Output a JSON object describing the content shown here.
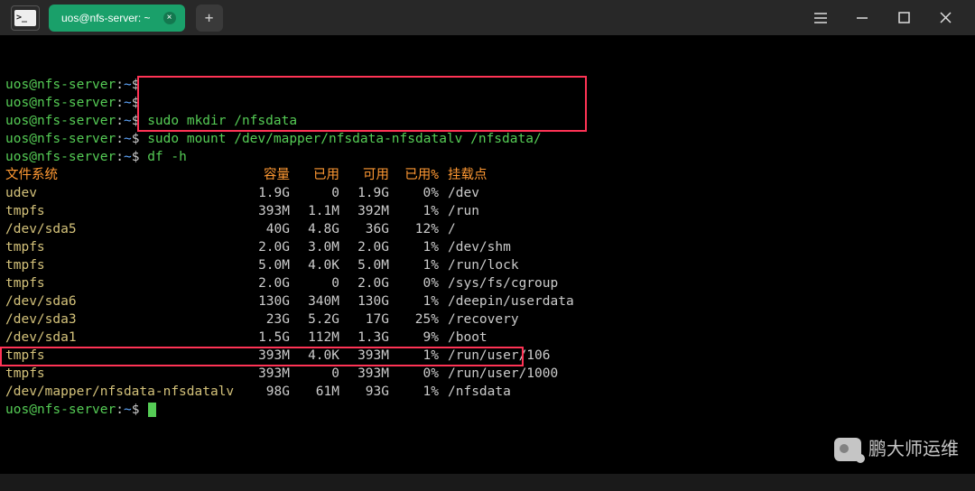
{
  "tab": {
    "title": "uos@nfs-server: ~"
  },
  "prompt": {
    "user": "uos",
    "host": "nfs-server",
    "path": "~",
    "symbol": "$"
  },
  "commands": [
    "",
    "",
    "sudo mkdir /nfsdata",
    "sudo mount /dev/mapper/nfsdata-nfsdatalv /nfsdata/",
    "df -h"
  ],
  "df": {
    "header": {
      "fs": "文件系统",
      "size": "容量",
      "used": "已用",
      "avail": "可用",
      "usep": "已用%",
      "mount": "挂载点"
    },
    "rows": [
      {
        "fs": "udev",
        "size": "1.9G",
        "used": "0",
        "avail": "1.9G",
        "usep": "0%",
        "mount": "/dev"
      },
      {
        "fs": "tmpfs",
        "size": "393M",
        "used": "1.1M",
        "avail": "392M",
        "usep": "1%",
        "mount": "/run"
      },
      {
        "fs": "/dev/sda5",
        "size": "40G",
        "used": "4.8G",
        "avail": "36G",
        "usep": "12%",
        "mount": "/"
      },
      {
        "fs": "tmpfs",
        "size": "2.0G",
        "used": "3.0M",
        "avail": "2.0G",
        "usep": "1%",
        "mount": "/dev/shm"
      },
      {
        "fs": "tmpfs",
        "size": "5.0M",
        "used": "4.0K",
        "avail": "5.0M",
        "usep": "1%",
        "mount": "/run/lock"
      },
      {
        "fs": "tmpfs",
        "size": "2.0G",
        "used": "0",
        "avail": "2.0G",
        "usep": "0%",
        "mount": "/sys/fs/cgroup"
      },
      {
        "fs": "/dev/sda6",
        "size": "130G",
        "used": "340M",
        "avail": "130G",
        "usep": "1%",
        "mount": "/deepin/userdata"
      },
      {
        "fs": "/dev/sda3",
        "size": "23G",
        "used": "5.2G",
        "avail": "17G",
        "usep": "25%",
        "mount": "/recovery"
      },
      {
        "fs": "/dev/sda1",
        "size": "1.5G",
        "used": "112M",
        "avail": "1.3G",
        "usep": "9%",
        "mount": "/boot"
      },
      {
        "fs": "tmpfs",
        "size": "393M",
        "used": "4.0K",
        "avail": "393M",
        "usep": "1%",
        "mount": "/run/user/106"
      },
      {
        "fs": "tmpfs",
        "size": "393M",
        "used": "0",
        "avail": "393M",
        "usep": "0%",
        "mount": "/run/user/1000"
      },
      {
        "fs": "/dev/mapper/nfsdata-nfsdatalv",
        "size": "98G",
        "used": "61M",
        "avail": "93G",
        "usep": "1%",
        "mount": "/nfsdata"
      }
    ]
  },
  "watermark": "鹏大师运维"
}
